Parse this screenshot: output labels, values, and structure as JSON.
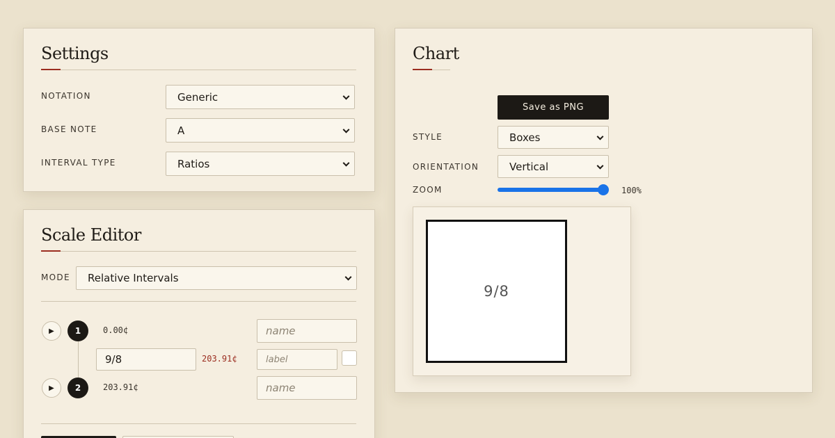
{
  "settings": {
    "title": "Settings",
    "notation_label": "NOTATION",
    "notation_value": "Generic",
    "base_note_label": "BASE NOTE",
    "base_note_value": "A",
    "interval_type_label": "INTERVAL TYPE",
    "interval_type_value": "Ratios"
  },
  "scale_editor": {
    "title": "Scale Editor",
    "mode_label": "MODE",
    "mode_value": "Relative Intervals",
    "steps": [
      {
        "number": "1",
        "cents": "0.00¢",
        "name_placeholder": "name"
      },
      {
        "number": "2",
        "cents": "203.91¢",
        "name_placeholder": "name"
      }
    ],
    "intervals": [
      {
        "value": "9/8",
        "cents": "203.91¢",
        "label_placeholder": "label",
        "checked": false
      }
    ],
    "play_icon": "▶"
  },
  "chart": {
    "title": "Chart",
    "save_button_label": "Save as PNG",
    "style_label": "STYLE",
    "style_value": "Boxes",
    "orientation_label": "ORIENTATION",
    "orientation_value": "Vertical",
    "zoom_label": "ZOOM",
    "zoom_value": "100%",
    "zoom_level": 1.0,
    "box_label": "9/8"
  },
  "colors": {
    "accent": "#9b2d20",
    "slider": "#1a73e8",
    "dark": "#1c1915",
    "background": "#ebe2cd",
    "panel": "#f5eee0"
  }
}
